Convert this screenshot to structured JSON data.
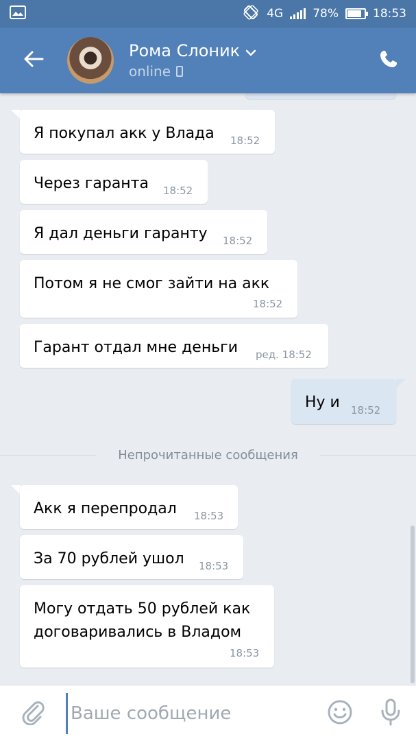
{
  "status_bar": {
    "network": "4G",
    "battery_percent": "78%",
    "battery_level": 0.78,
    "time": "18:53"
  },
  "header": {
    "contact_name": "Рома Слоник",
    "contact_status": "online"
  },
  "messages": [
    {
      "text": "Я покупал акк у Влада",
      "time": "18:52",
      "direction": "in"
    },
    {
      "text": "Через гаранта",
      "time": "18:52",
      "direction": "in"
    },
    {
      "text": "Я дал деньги гаранту",
      "time": "18:52",
      "direction": "in"
    },
    {
      "text": "Потом я не смог зайти на акк",
      "time": "18:52",
      "direction": "in"
    },
    {
      "text": "Гарант отдал мне деньги",
      "time": "ред. 18:52",
      "direction": "in"
    },
    {
      "text": "Ну и",
      "time": "18:52",
      "direction": "out"
    },
    {
      "text": "Акк я перепродал",
      "time": "18:53",
      "direction": "in"
    },
    {
      "text": "За 70 рублей ушол",
      "time": "18:53",
      "direction": "in"
    },
    {
      "text": "Могу отдать 50 рублей как договаривались в Владом",
      "time": "18:53",
      "direction": "in"
    }
  ],
  "unread_divider": "Непрочитанные сообщения",
  "composer": {
    "placeholder": "Ваше сообщение"
  },
  "icons": {
    "back": "arrow-left-icon",
    "call": "phone-icon",
    "attach": "paperclip-icon",
    "emoji": "smile-icon",
    "mic": "microphone-icon"
  },
  "colors": {
    "header": "#5181b8",
    "status_bar": "#4a76a8",
    "chat_background": "#e9edf1",
    "incoming_bubble": "#ffffff",
    "outgoing_bubble": "#dbe6f3"
  }
}
